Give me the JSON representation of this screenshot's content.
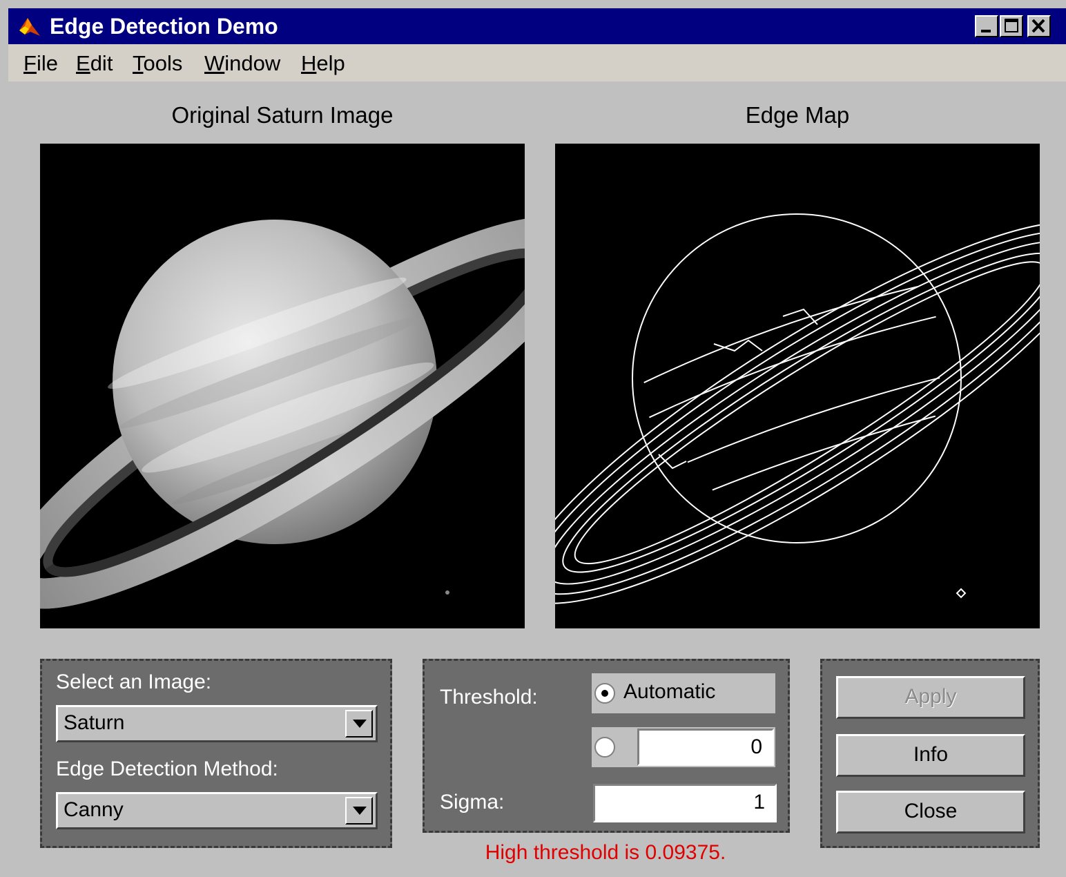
{
  "window": {
    "title": "Edge Detection Demo",
    "controls": [
      "_",
      "□",
      "X"
    ]
  },
  "menu": {
    "file": {
      "mnemonic": "F",
      "rest": "ile"
    },
    "edit": {
      "mnemonic": "E",
      "rest": "dit"
    },
    "tools": {
      "mnemonic": "T",
      "rest": "ools"
    },
    "window": {
      "mnemonic": "W",
      "rest": "indow"
    },
    "help": {
      "mnemonic": "H",
      "rest": "elp"
    }
  },
  "axes": {
    "original_title": "Original Saturn Image",
    "edge_title": "Edge Map"
  },
  "image_panel": {
    "select_label": "Select an Image:",
    "image_value": "Saturn",
    "method_label": "Edge Detection Method:",
    "method_value": "Canny"
  },
  "threshold_panel": {
    "threshold_label": "Threshold:",
    "automatic_label": "Automatic",
    "automatic_selected": true,
    "manual_value": "0",
    "sigma_label": "Sigma:",
    "sigma_value": "1"
  },
  "buttons": {
    "apply": "Apply",
    "info": "Info",
    "close": "Close"
  },
  "status": {
    "message": "High threshold is 0.09375."
  },
  "colors": {
    "title_bar": "#000080",
    "status_text": "#e00000",
    "panel": "#6c6c6c"
  }
}
